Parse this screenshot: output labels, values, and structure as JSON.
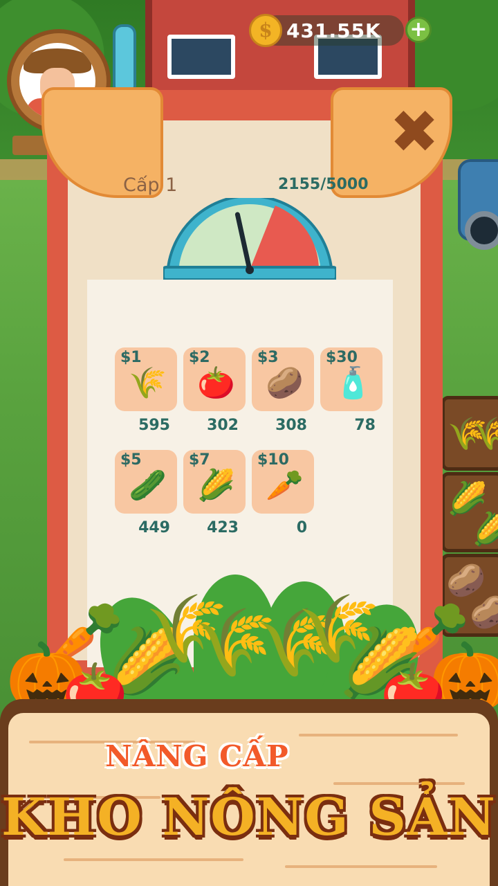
{
  "hud": {
    "coins": "431.55K",
    "coin_symbol": "$",
    "add_coins_symbol": "+"
  },
  "dialog": {
    "close_symbol": "✖",
    "level_label": "Cấp 1",
    "progress_text": "2155/5000",
    "progress_fraction": 0.431,
    "products": [
      {
        "price": "$1",
        "icon": "wheat-icon",
        "glyph": "🌾",
        "count": "595"
      },
      {
        "price": "$2",
        "icon": "tomato-icon",
        "glyph": "🍅",
        "count": "302"
      },
      {
        "price": "$3",
        "icon": "potato-icon",
        "glyph": "🥔",
        "count": "308"
      },
      {
        "price": "$30",
        "icon": "bottle-icon",
        "glyph": "🧴",
        "count": "78"
      },
      {
        "price": "$5",
        "icon": "cucumber-icon",
        "glyph": "🥒",
        "count": "449"
      },
      {
        "price": "$7",
        "icon": "corn-icon",
        "glyph": "🌽",
        "count": "423"
      },
      {
        "price": "$10",
        "icon": "carrot-icon",
        "glyph": "🥕",
        "count": "0"
      }
    ]
  },
  "banner": {
    "subtitle": "NÂNG CẤP",
    "title": "KHO NÔNG SẢN"
  },
  "colors": {
    "dialog_red": "#dd5b44",
    "tile_bg": "#f8c7a2",
    "value_teal": "#2b6b63",
    "banner_gold": "#f4b125"
  }
}
